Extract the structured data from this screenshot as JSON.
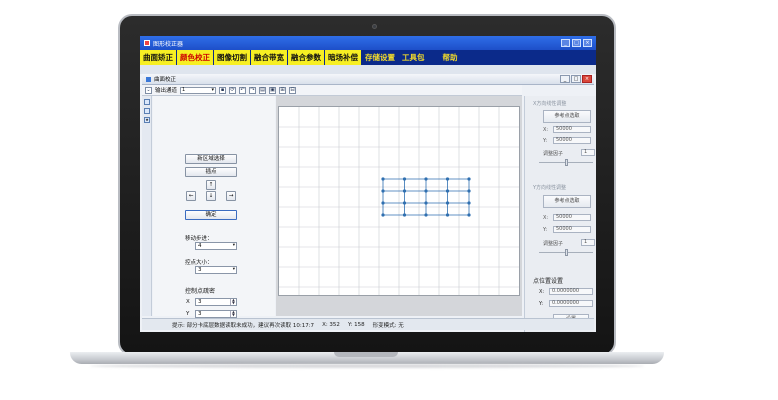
{
  "main_window": {
    "title": "图形校正器"
  },
  "menu": [
    {
      "label": "曲面矫正",
      "active": false,
      "style": "yellow"
    },
    {
      "label": "颜色校正",
      "active": true,
      "style": "yellow"
    },
    {
      "label": "图像切割",
      "active": false,
      "style": "yellow"
    },
    {
      "label": "融合带宽",
      "active": false,
      "style": "yellow"
    },
    {
      "label": "融合参数",
      "active": false,
      "style": "yellow"
    },
    {
      "label": "暗场补偿",
      "active": false,
      "style": "yellow"
    },
    {
      "label": "存储设置",
      "active": false,
      "style": "dark"
    },
    {
      "label": "工具包",
      "active": false,
      "style": "dark"
    },
    {
      "label": "帮助",
      "active": false,
      "style": "dark"
    }
  ],
  "child_window": {
    "title": "曲面校正"
  },
  "toolbar": {
    "output_channel_label": "输出通道",
    "output_channel_value": "1"
  },
  "left_panel": {
    "region_select_button": "新区域选择",
    "insert_point_button": "插点",
    "arrow_up": "↑",
    "arrow_left": "←",
    "arrow_down": "↓",
    "arrow_right": "→",
    "confirm_button": "确定",
    "move_step_label": "移动步进：",
    "move_step_value": "4",
    "point_size_label": "控点大小：",
    "point_size_value": "3",
    "control_density_label": "控制点疏密",
    "x_label": "X",
    "x_value": "3",
    "y_label": "Y",
    "y_value": "3"
  },
  "right_panel": {
    "x_group_title": "X方向线性调整",
    "x_ref_button": "参考点选取",
    "x_row1_label": "X:",
    "x_row1_value": "50000",
    "x_row2_label": "Y:",
    "x_row2_value": "50000",
    "x_factor_label": "调整因子",
    "x_factor_value": "1",
    "y_group_title": "Y方向线性调整",
    "y_ref_button": "参考点选取",
    "y_row1_label": "X:",
    "y_row1_value": "50000",
    "y_row2_label": "Y:",
    "y_row2_value": "50000",
    "y_factor_label": "调整因子",
    "y_factor_value": "1",
    "point_pos_heading": "点位置设置",
    "pos_x_label": "X:",
    "pos_x_value": "0.0000000",
    "pos_y_label": "Y:",
    "pos_y_value": "0.0000000",
    "set_button": "设置"
  },
  "status_bar": {
    "message": "提示: 部分卡底层数据读取未成功，建议再次读取 10:17:7",
    "x": "X: 352",
    "y": "Y: 158",
    "mode": "形变模式: 无"
  },
  "colors": {
    "menu_yellow": "#f7ef23",
    "menu_dark": "#0b2a8a",
    "title_blue": "#1d4fc9",
    "control_point": "#2f6fb0"
  },
  "grid": {
    "columns": 5,
    "rows": 4
  }
}
